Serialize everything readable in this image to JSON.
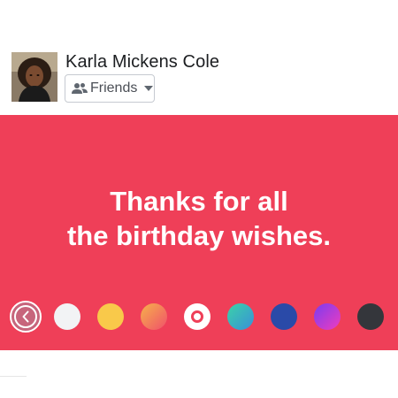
{
  "author": {
    "name": "Karla Mickens Cole"
  },
  "audience": {
    "label": "Friends",
    "icon": "friends-icon"
  },
  "post": {
    "background_color": "#ef3f58",
    "text_lines": [
      "Thanks for all",
      "the birthday wishes."
    ]
  },
  "color_picker": {
    "back_icon": "chevron-left-icon",
    "swatches": [
      {
        "name": "white",
        "fill": "#f2f3f5"
      },
      {
        "name": "yellow",
        "fill": "#f9c94a"
      },
      {
        "name": "orange-pink-gradient",
        "fill": "linear-gradient(135deg,#f6b24a,#f0506b)"
      },
      {
        "name": "selected-red",
        "fill": "#ffffff",
        "selected": true
      },
      {
        "name": "teal-green-gradient",
        "fill": "linear-gradient(135deg,#3bd3a6,#3a8fd9)"
      },
      {
        "name": "blue",
        "fill": "#2a4aa8"
      },
      {
        "name": "purple-magenta-gradient",
        "fill": "linear-gradient(135deg,#7b3cf0,#f03cbe)"
      },
      {
        "name": "dark-gray",
        "fill": "#34363b"
      }
    ]
  }
}
